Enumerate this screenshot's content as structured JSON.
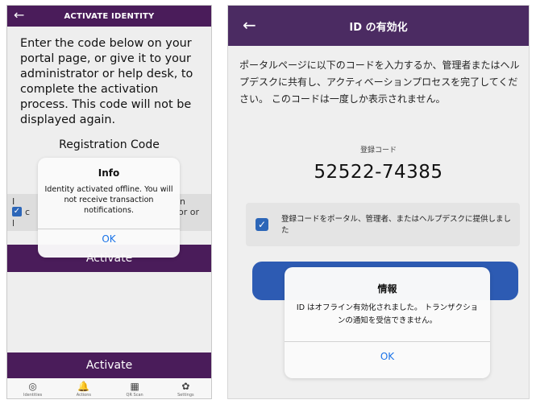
{
  "left": {
    "header": {
      "back_icon": "←",
      "title": "ACTIVATE IDENTITY"
    },
    "instructions": "Enter the code below on your portal page, or give it to your administrator or help desk, to complete the activation process. This code will not be displayed again.",
    "registration_code_label": "Registration Code",
    "checkbox_checked": true,
    "peek_texts": [
      "I",
      "n",
      "c",
      "or or",
      "l"
    ],
    "activate_label": "Activate",
    "bottom_activate_label": "Activate",
    "tabs": [
      {
        "icon": "fingerprint-icon",
        "glyph": "◎",
        "label": "Identities"
      },
      {
        "icon": "bell-icon",
        "glyph": "🔔",
        "label": "Actions"
      },
      {
        "icon": "qr-code-icon",
        "glyph": "▦",
        "label": "QR Scan"
      },
      {
        "icon": "gear-icon",
        "glyph": "✿",
        "label": "Settings"
      }
    ],
    "alert": {
      "title": "Info",
      "message": "Identity activated offline. You will not receive transaction notifications.",
      "ok_label": "OK"
    }
  },
  "right": {
    "header": {
      "back_icon": "←",
      "title": "ID の有効化"
    },
    "instructions": "ポータルページに以下のコードを入力するか、管理者またはヘルプデスクに共有し、アクティベーションプロセスを完了してください。 このコードは一度しか表示されません。",
    "registration_code_label": "登録コード",
    "registration_code": "52522-74385",
    "checkbox_checked": true,
    "checkbox_text": "登録コードをポータル、管理者、またはヘルプデスクに提供しました",
    "alert": {
      "title": "情報",
      "message": "ID はオフライン有効化されました。 トランザクションの通知を受信できません。",
      "ok_label": "OK"
    }
  },
  "colors": {
    "left_header": "#4a1c5a",
    "right_header": "#4b2b62",
    "checkbox_blue": "#2c66b8",
    "ok_blue": "#1a73e8",
    "hidden_button_blue": "#2d5bb3"
  }
}
